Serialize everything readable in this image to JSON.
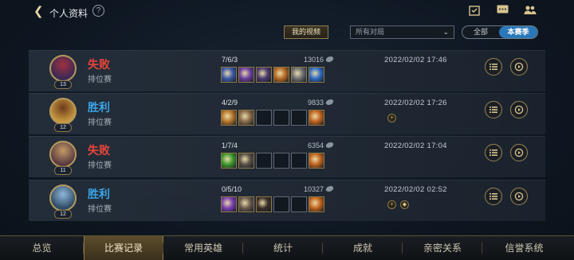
{
  "header": {
    "title": "个人资料",
    "help": "?",
    "back_icon": "chevron-left-icon",
    "icons": [
      "calendar-check-icon",
      "chat-icon",
      "friends-icon"
    ]
  },
  "filters": {
    "my_video_label": "我的视频",
    "mode_value": "所有对局",
    "tab_all": "全部",
    "tab_season": "本赛季"
  },
  "matches": [
    {
      "result": "失败",
      "outcome": "lose",
      "mode": "排位赛",
      "level": "13",
      "kda": "7/6/3",
      "gold": "13016",
      "datetime": "2022/02/02 17:46",
      "items": [
        {
          "filled": true,
          "color": "#3d5aa8"
        },
        {
          "filled": true,
          "color": "#6a3fa0"
        },
        {
          "filled": true,
          "color": "#4a3a6e"
        },
        {
          "filled": true,
          "color": "#b86a24"
        },
        {
          "filled": true,
          "color": "#6d6f72"
        },
        {
          "filled": true,
          "color": "#2f6cc4"
        }
      ],
      "badges": []
    },
    {
      "result": "胜利",
      "outcome": "win",
      "mode": "排位赛",
      "level": "12",
      "kda": "4/2/9",
      "gold": "9833",
      "datetime": "2022/02/02 17:26",
      "items": [
        {
          "filled": true,
          "color": "#b8772a"
        },
        {
          "filled": true,
          "color": "#8a6a4a"
        },
        {
          "filled": false
        },
        {
          "filled": false
        },
        {
          "filled": false
        },
        {
          "filled": true,
          "color": "#c2641e"
        }
      ],
      "badges": [
        "+"
      ]
    },
    {
      "result": "失败",
      "outcome": "lose",
      "mode": "排位赛",
      "level": "11",
      "kda": "1/7/4",
      "gold": "6354",
      "datetime": "2022/02/02 17:04",
      "items": [
        {
          "filled": true,
          "color": "#3f9a2e"
        },
        {
          "filled": true,
          "color": "#5a5048"
        },
        {
          "filled": false
        },
        {
          "filled": false
        },
        {
          "filled": false
        },
        {
          "filled": true,
          "color": "#c2641e"
        }
      ],
      "badges": []
    },
    {
      "result": "胜利",
      "outcome": "win",
      "mode": "排位赛",
      "level": "12",
      "kda": "0/5/10",
      "gold": "10327",
      "datetime": "2022/02/02 02:52",
      "items": [
        {
          "filled": true,
          "color": "#7a3fb0"
        },
        {
          "filled": true,
          "color": "#6a5a4e"
        },
        {
          "filled": true,
          "color": "#3a2f28"
        },
        {
          "filled": false
        },
        {
          "filled": false
        },
        {
          "filled": true,
          "color": "#c2641e"
        }
      ],
      "badges": [
        "+",
        "◆"
      ]
    }
  ],
  "nav": [
    {
      "label": "总览",
      "active": false
    },
    {
      "label": "比赛记录",
      "active": true
    },
    {
      "label": "常用英雄",
      "active": false
    },
    {
      "label": "统计",
      "active": false
    },
    {
      "label": "成就",
      "active": false
    },
    {
      "label": "亲密关系",
      "active": false
    },
    {
      "label": "信誉系统",
      "active": false
    }
  ],
  "colors": {
    "accent_gold": "#d8c48f",
    "lose_red": "#e6463a",
    "win_blue": "#3ba3e6",
    "season_tab_blue": "#2b78b8"
  }
}
